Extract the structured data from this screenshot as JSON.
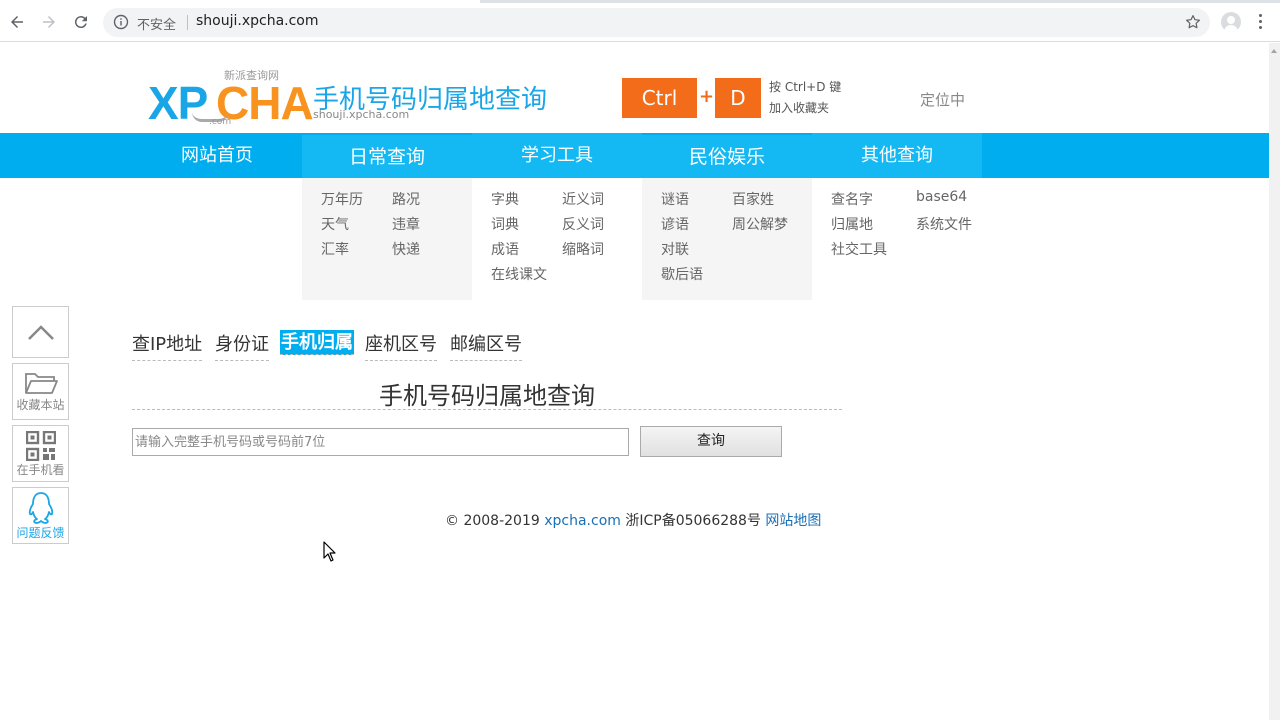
{
  "browser": {
    "insecure_label": "不安全",
    "url": "shouji.xpcha.com"
  },
  "header": {
    "logo_main_blue": "XP",
    "logo_main_orange": "CHA",
    "logo_tagline": "新派查询网",
    "logo_com": ".com",
    "title": "手机号码归属地查询",
    "domain": "shouji.xpcha.com",
    "ctrl_key": "Ctrl",
    "plus": "+",
    "d_key": "D",
    "bookmark_hint_line1": "按 Ctrl+D 键",
    "bookmark_hint_line2": "加入收藏夹",
    "location_status": "定位中"
  },
  "nav": {
    "items": [
      {
        "label": "网站首页"
      },
      {
        "label": "日常查询"
      },
      {
        "label": "学习工具"
      },
      {
        "label": "民俗娱乐"
      },
      {
        "label": "其他查询"
      }
    ]
  },
  "dropdown": {
    "daily": [
      "万年历",
      "路况",
      "天气",
      "违章",
      "汇率",
      "快递"
    ],
    "study": [
      "字典",
      "近义词",
      "词典",
      "反义词",
      "成语",
      "缩略词",
      "在线课文"
    ],
    "folk": [
      "谜语",
      "百家姓",
      "谚语",
      "周公解梦",
      "对联",
      "歇后语"
    ],
    "other": [
      "查名字",
      "base64",
      "归属地",
      "系统文件",
      "社交工具"
    ]
  },
  "sidebar": {
    "bookmark_label": "收藏本站",
    "mobile_label": "在手机看",
    "feedback_label": "问题反馈"
  },
  "tabs": [
    {
      "label": "查IP地址"
    },
    {
      "label": "身份证"
    },
    {
      "label": "手机归属"
    },
    {
      "label": "座机区号"
    },
    {
      "label": "邮编区号"
    }
  ],
  "main": {
    "heading": "手机号码归属地查询",
    "search_placeholder": "请输入完整手机号码或号码前7位",
    "query_button": "查询"
  },
  "footer": {
    "copyright": "© 2008-2019",
    "site_link": "xpcha.com",
    "icp": "浙ICP备05066288号",
    "sitemap_link": "网站地图"
  },
  "colors": {
    "brand_blue": "#00aeef",
    "brand_orange": "#f26c1a"
  }
}
